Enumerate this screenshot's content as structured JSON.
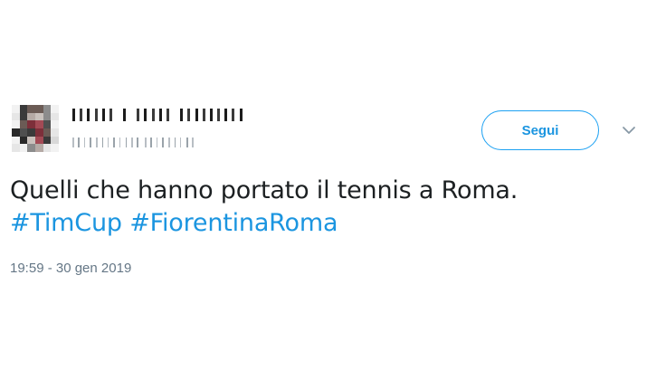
{
  "tweet": {
    "follow_button_label": "Segui",
    "text": "Quelli che hanno portato il tennis a Roma.",
    "hashtags": [
      "#TimCup",
      "#FiorentinaRoma"
    ],
    "timestamp": "19:59 - 30 gen 2019"
  },
  "colors": {
    "link": "#1b95e0",
    "text": "#1c2022",
    "muted": "#657786",
    "button_border": "#1da1f2"
  },
  "icons": {
    "avatar": "pixelated-avatar",
    "menu": "chevron-down-icon"
  }
}
